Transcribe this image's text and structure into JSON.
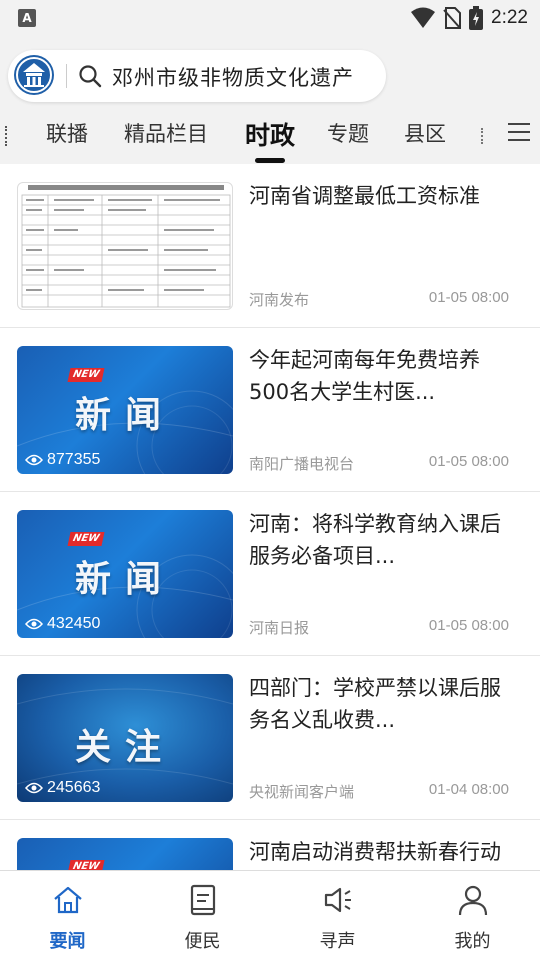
{
  "status_bar": {
    "time": "2:22",
    "notification_letter": "A"
  },
  "search": {
    "text": "邓州市级非物质文化遗产"
  },
  "tabs": [
    {
      "label": "联播",
      "active": false
    },
    {
      "label": "精品栏目",
      "active": false
    },
    {
      "label": "时政",
      "active": true
    },
    {
      "label": "专题",
      "active": false
    },
    {
      "label": "县区",
      "active": false
    }
  ],
  "feed": [
    {
      "title": "河南省调整最低工资标准",
      "source": "河南发布",
      "time": "01-05 08:00",
      "thumb_type": "document"
    },
    {
      "title": "今年起河南每年免费培养500名大学生村医...",
      "source": "南阳广播电视台",
      "time": "01-05 08:00",
      "thumb_type": "news",
      "thumb_word": "新闻",
      "badge": "NEW",
      "views": "877355"
    },
    {
      "title": "河南：将科学教育纳入课后服务必备项目...",
      "source": "河南日报",
      "time": "01-05 08:00",
      "thumb_type": "news",
      "thumb_word": "新闻",
      "badge": "NEW",
      "views": "432450"
    },
    {
      "title": "四部门：学校严禁以课后服务名义乱收费...",
      "source": "央视新闻客户端",
      "time": "01-04 08:00",
      "thumb_type": "focus",
      "thumb_word": "关注",
      "views": "245663"
    },
    {
      "title": "河南启动消费帮扶新春行动",
      "thumb_type": "news",
      "badge": "NEW"
    }
  ],
  "bottom_nav": [
    {
      "label": "要闻",
      "icon": "home-icon",
      "active": true
    },
    {
      "label": "便民",
      "icon": "document-icon",
      "active": false
    },
    {
      "label": "寻声",
      "icon": "speaker-icon",
      "active": false
    },
    {
      "label": "我的",
      "icon": "person-icon",
      "active": false
    }
  ],
  "colors": {
    "accent": "#1f67c7",
    "news_blue": "#1a5fb4",
    "badge_red": "#e32b2b"
  }
}
